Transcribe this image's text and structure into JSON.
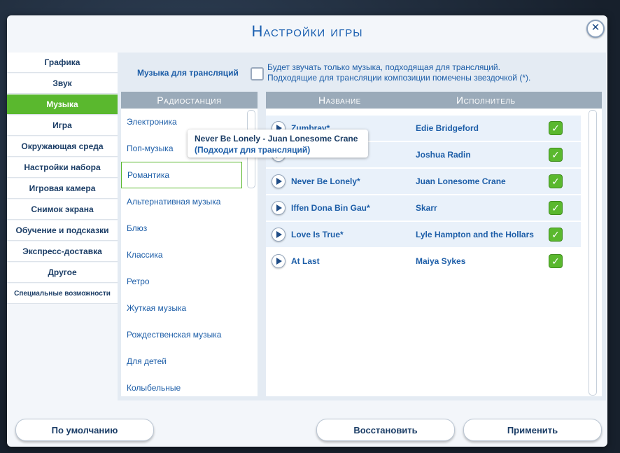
{
  "dialog": {
    "title": "Настройки игры"
  },
  "sidebar": {
    "items": [
      {
        "label": "Графика"
      },
      {
        "label": "Звук"
      },
      {
        "label": "Музыка"
      },
      {
        "label": "Игра"
      },
      {
        "label": "Окружающая среда"
      },
      {
        "label": "Настройки набора"
      },
      {
        "label": "Игровая камера"
      },
      {
        "label": "Снимок экрана"
      },
      {
        "label": "Обучение и подсказки"
      },
      {
        "label": "Экспресс-доставка"
      },
      {
        "label": "Другое"
      },
      {
        "label": "Специальные возможности"
      }
    ],
    "active": "Музыка"
  },
  "streaming": {
    "label": "Музыка для трансляций",
    "checked": false,
    "desc_line1": "Будет звучать только музыка, подходящая для трансляций.",
    "desc_line2": "Подходящие для трансляции композиции помечены звездочкой (*)."
  },
  "headers": {
    "station": "Радиостанция",
    "name": "Название",
    "artist": "Исполнитель"
  },
  "stations": [
    {
      "label": "Электроника"
    },
    {
      "label": "Поп-музыка"
    },
    {
      "label": "Романтика"
    },
    {
      "label": "Альтернативная музыка"
    },
    {
      "label": "Блюз"
    },
    {
      "label": "Классика"
    },
    {
      "label": "Ретро"
    },
    {
      "label": "Жуткая музыка"
    },
    {
      "label": "Рождественская музыка"
    },
    {
      "label": "Для детей"
    },
    {
      "label": "Колыбельные"
    }
  ],
  "selected_station": "Романтика",
  "songs": [
    {
      "name": "Zumbrav*",
      "artist": "Edie Bridgeford",
      "enabled": true
    },
    {
      "name": "",
      "artist": "Joshua Radin",
      "enabled": true
    },
    {
      "name": "Never Be Lonely*",
      "artist": "Juan Lonesome Crane",
      "enabled": true
    },
    {
      "name": "Iffen Dona Bin Gau*",
      "artist": "Skarr",
      "enabled": true
    },
    {
      "name": "Love Is True*",
      "artist": "Lyle Hampton and the Hollars",
      "enabled": true
    },
    {
      "name": "At Last",
      "artist": "Maiya Sykes",
      "enabled": true
    }
  ],
  "tooltip": {
    "line1": "Never Be Lonely - Juan Lonesome Crane",
    "line2": "(Подходит для трансляций)"
  },
  "buttons": {
    "default": "По умолчанию",
    "restore": "Восстановить",
    "apply": "Применить"
  },
  "colors": {
    "accent": "#5ab82e",
    "text_blue": "#1d5ea8",
    "header": "#9aaab9"
  }
}
